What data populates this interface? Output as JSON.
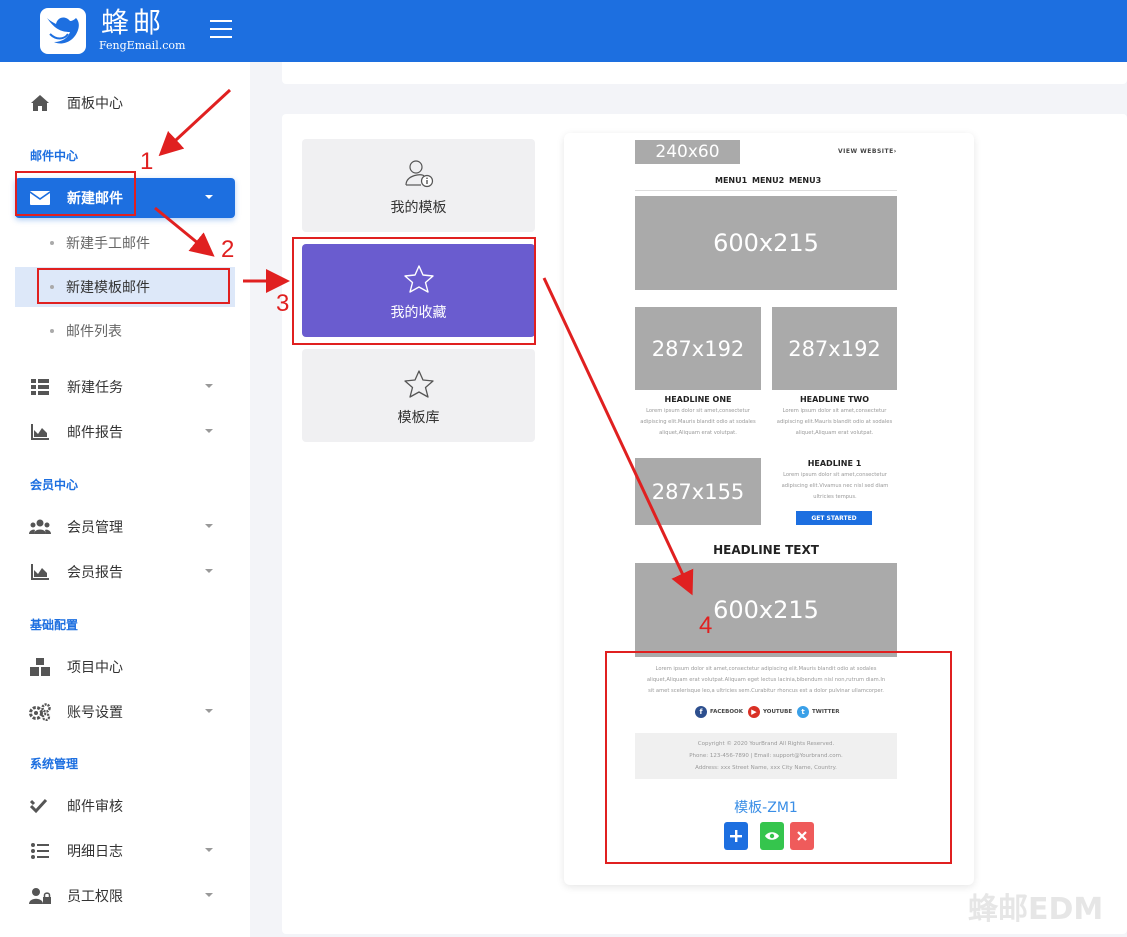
{
  "brand": {
    "title": "蜂邮",
    "subtitle": "FengEmail.com"
  },
  "sidebar": {
    "dashboard": "面板中心",
    "sections": {
      "mail": "邮件中心",
      "member": "会员中心",
      "config": "基础配置",
      "system": "系统管理"
    },
    "new_mail": "新建邮件",
    "sub_items": [
      "新建手工邮件",
      "新建模板邮件",
      "邮件列表"
    ],
    "new_task": "新建任务",
    "mail_report": "邮件报告",
    "member_manage": "会员管理",
    "member_report": "会员报告",
    "project_center": "项目中心",
    "account_settings": "账号设置",
    "mail_review": "邮件审核",
    "detail_log": "明细日志",
    "staff_permission": "员工权限"
  },
  "tabs": [
    "我的模板",
    "我的收藏",
    "模板库"
  ],
  "template": {
    "logo_ph": "240x60",
    "view_website": "VIEW WEBSITE›",
    "menus": [
      "MENU1",
      "MENU2",
      "MENU3"
    ],
    "hero_ph": "600x215",
    "col_ph": "287x192",
    "headline_one": "HEADLINE ONE",
    "headline_two": "HEADLINE TWO",
    "col_text": "Lorem ipsum dolor sit amet,consectetur adipiscing elit.Mauris blandit odio at sodales aliquet,Aliquam erat volutpat.",
    "side_ph": "287x155",
    "headline_1": "HEADLINE 1",
    "side_text": "Lorem ipsum dolor sit amet,consectetur adipiscing elit.Vivamus nec nisl sed diam ultricies tempus.",
    "cta": "GET STARTED",
    "headline_text": "HEADLINE TEXT",
    "hero2_ph": "600x215",
    "body_text": "Lorem ipsum dolor sit amet,consectetur adipiscing elit.Mauris blandit odio at sodales aliquet,Aliquam erat volutpat.Aliquam eget lectus lacinia,bibendum nisl non,rutrum diam.In sit amet scelerisque leo,a ultricies sem.Curabitur rhoncus est a dolor pulvinar ullamcorper.",
    "social": [
      "FACEBOOK",
      "YOUTUBE",
      "TWITTER"
    ],
    "footer_lines": [
      "Copyright © 2020 YourBrand All Rights Reserved.",
      "Phone: 123-456-7890 | Email: support@Yourbrand.com.",
      "Address: xxx Street Name, xxx City Name, Country."
    ],
    "name": "模板-ZM1"
  },
  "annotations": [
    "1",
    "2",
    "3",
    "4"
  ],
  "watermark": "蜂邮EDM",
  "colors": {
    "primary": "#1d6fe0",
    "purple": "#6a5ccf",
    "add": "#1d6fe0",
    "preview": "#35c54d",
    "delete": "#ef5b5b",
    "annotation": "#e02020"
  }
}
